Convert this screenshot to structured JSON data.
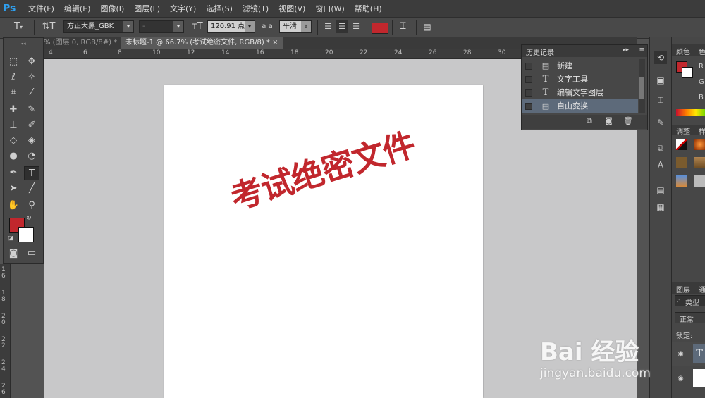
{
  "app": {
    "logo": "Ps"
  },
  "menu": [
    "文件(F)",
    "编辑(E)",
    "图像(I)",
    "图层(L)",
    "文字(Y)",
    "选择(S)",
    "滤镜(T)",
    "视图(V)",
    "窗口(W)",
    "帮助(H)"
  ],
  "options": {
    "font_family": "方正大黑_GBK",
    "font_style": "-",
    "font_size": "120.91 点",
    "antialias_symbol": "a a",
    "antialias": "平滑",
    "text_color": "#c1272d"
  },
  "tabs": [
    {
      "label": "% (图层 0, RGB/8#) *",
      "close": "×"
    },
    {
      "label": "未标题-1 @ 66.7% (考试绝密文件, RGB/8) *",
      "close": "×"
    }
  ],
  "ruler": {
    "top": [
      "2",
      "4",
      "6",
      "8",
      "10",
      "12",
      "14",
      "16",
      "18",
      "20",
      "22",
      "24",
      "26",
      "28",
      "30"
    ],
    "left": [
      "1 6",
      "1 8",
      "2 0",
      "2 2",
      "2 4",
      "2 6"
    ]
  },
  "canvas": {
    "text": "考试绝密文件"
  },
  "history": {
    "title": "历史记录",
    "items": [
      {
        "label": "新建",
        "icon": "document-icon"
      },
      {
        "label": "文字工具",
        "icon": "text-tool-icon"
      },
      {
        "label": "编辑文字图层",
        "icon": "text-tool-icon"
      },
      {
        "label": "自由变换",
        "icon": "document-icon",
        "selected": true
      }
    ]
  },
  "right_panel": {
    "color_tab": "颜色",
    "color_tab2": "色",
    "channels": [
      "R",
      "G",
      "B"
    ],
    "adjust_tab": "调整",
    "adjust_tab2": "样",
    "layers_tab": "图层",
    "layers_tab2": "通",
    "layers_filter": "类型",
    "blend_mode": "正常",
    "lock_label": "锁定:"
  },
  "watermark": {
    "logo": "Bai 经验",
    "url": "jingyan.baidu.com"
  },
  "colors": {
    "foreground": "#c1272d",
    "background": "#ffffff",
    "accent": "#2fa0f0"
  }
}
